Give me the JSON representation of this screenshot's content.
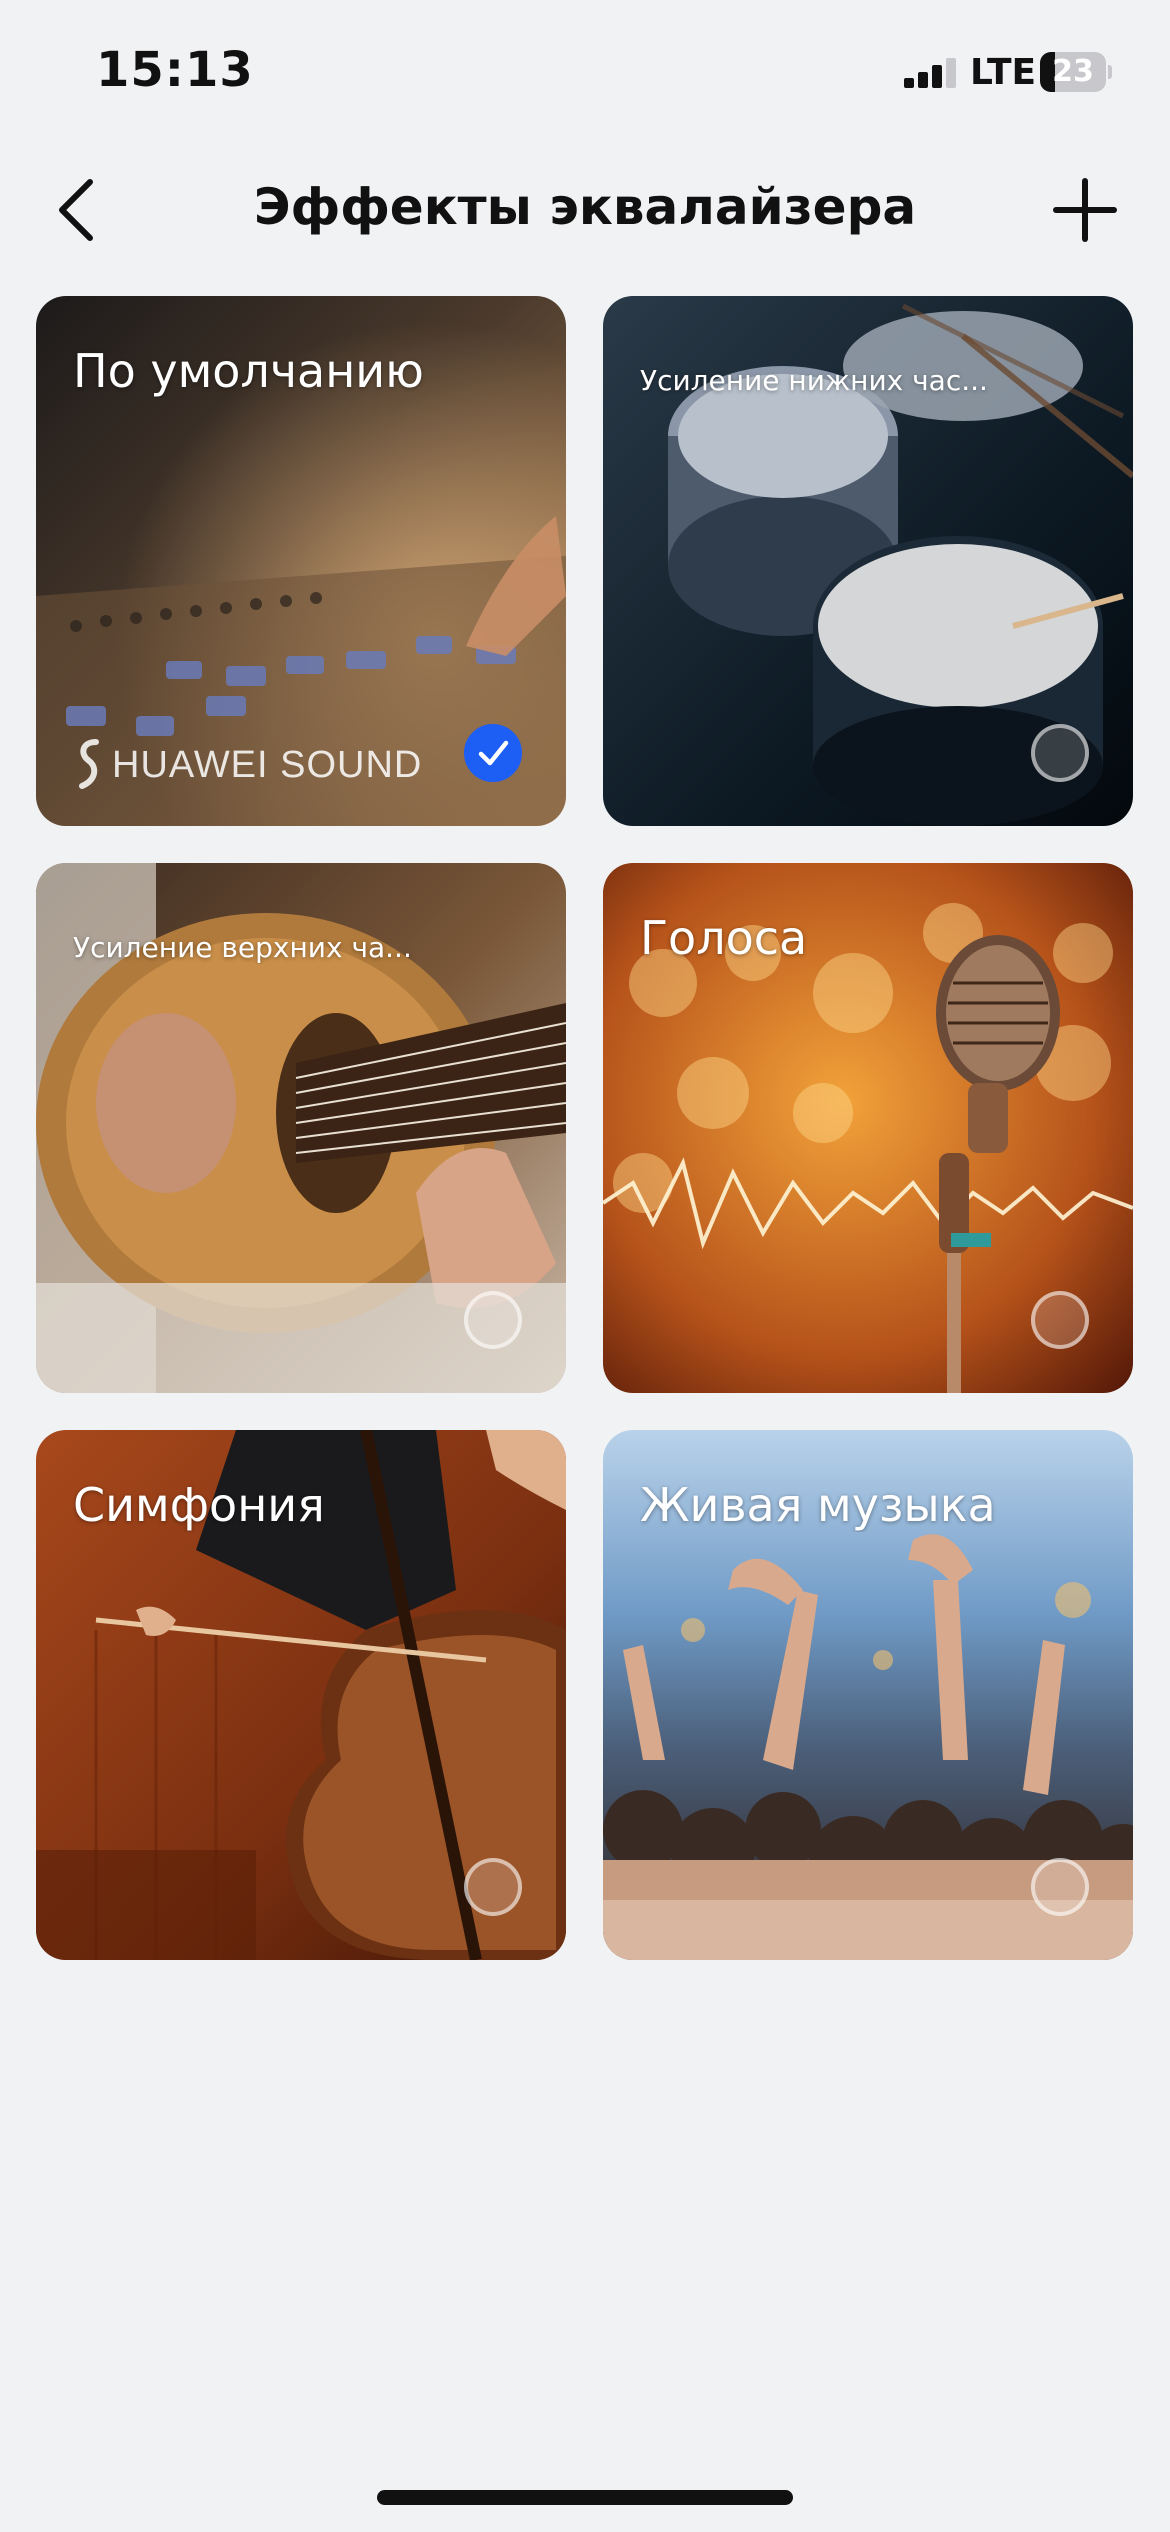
{
  "status_bar": {
    "time": "15:13",
    "network": "LTE",
    "battery_level": "23",
    "battery_fraction": 0.23,
    "signal_icon": "cellular-signal-icon"
  },
  "header": {
    "title": "Эффекты эквалайзера",
    "back_icon": "chevron-left-icon",
    "add_icon": "plus-icon"
  },
  "presets": [
    {
      "label": "По умолчанию",
      "selected": true,
      "brand": "HUAWEI SOUND"
    },
    {
      "label": "Усиление нижних час...",
      "selected": false
    },
    {
      "label": "Усиление верхних ча...",
      "selected": false
    },
    {
      "label": "Голоса",
      "selected": false
    },
    {
      "label": "Симфония",
      "selected": false
    },
    {
      "label": "Живая музыка",
      "selected": false
    }
  ],
  "colors": {
    "accent": "#1d5ef5",
    "background": "#f1f2f4",
    "text": "#111111"
  }
}
